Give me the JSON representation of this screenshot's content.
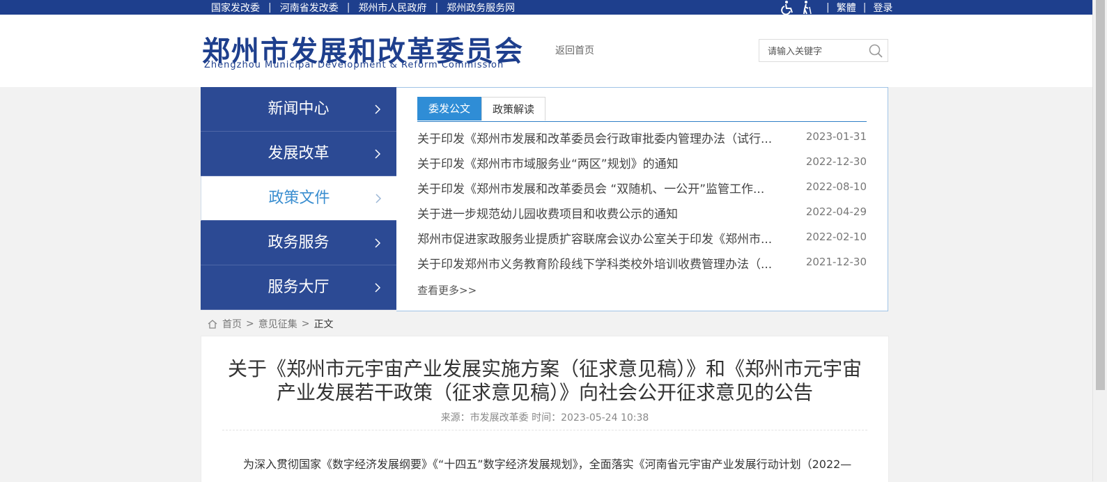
{
  "topbar": {
    "links": [
      "国家发改委",
      "河南省发改委",
      "郑州市人民政府",
      "郑州政务服务网"
    ],
    "traditional": "繁體",
    "login": "登录"
  },
  "header": {
    "logo_cn": "郑州市发展和改革委员会",
    "logo_en": "Zhengzhou Municipal Development & Reform Commission",
    "home_link": "返回首页",
    "search_placeholder": "请输入关键字"
  },
  "menu": {
    "items": [
      {
        "label": "新闻中心"
      },
      {
        "label": "发展改革"
      },
      {
        "label": "政策文件"
      },
      {
        "label": "政务服务"
      },
      {
        "label": "服务大厅"
      }
    ]
  },
  "panel": {
    "tabs": [
      "委发公文",
      "政策解读"
    ],
    "news": [
      {
        "title": "关于印发《郑州市发展和改革委员会行政审批委内管理办法（试行...",
        "date": "2023-01-31"
      },
      {
        "title": "关于印发《郑州市市域服务业“两区”规划》的通知",
        "date": "2022-12-30"
      },
      {
        "title": "关于印发《郑州市发展和改革委员会 “双随机、一公开”监管工作...",
        "date": "2022-08-10"
      },
      {
        "title": "关于进一步规范幼儿园收费项目和收费公示的通知",
        "date": "2022-04-29"
      },
      {
        "title": "郑州市促进家政服务业提质扩容联席会议办公室关于印发《郑州市...",
        "date": "2022-02-10"
      },
      {
        "title": "关于印发郑州市义务教育阶段线下学科类校外培训收费管理办法（...",
        "date": "2021-12-30"
      }
    ],
    "more": "查看更多>>"
  },
  "breadcrumb": {
    "home": "首页",
    "section": "意见征集",
    "current": "正文"
  },
  "article": {
    "title": "关于《郑州市元宇宙产业发展实施方案（征求意见稿）》和《郑州市元宇宙产业发展若干政策（征求意见稿）》向社会公开征求意见的公告",
    "meta": "来源：市发展改革委  时间：2023-05-24 10:38",
    "body": "为深入贯彻国家《数字经济发展纲要》《“十四五”数字经济发展规划》，全面落实《河南省元宇宙产业发展行动计划（2022—"
  }
}
